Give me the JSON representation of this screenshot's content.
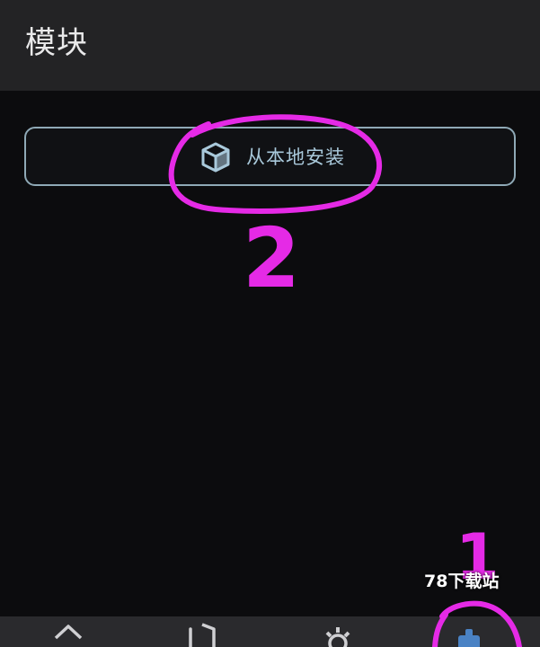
{
  "app_bar": {
    "title": "模块"
  },
  "install": {
    "label": "从本地安装",
    "icon": "package-icon"
  },
  "annotations": {
    "step1": "1",
    "step2": "2",
    "color": "#e52ae6"
  },
  "watermark": {
    "text": "78下载站"
  },
  "bottom_nav": {
    "items": [
      {
        "icon": "home-icon"
      },
      {
        "icon": "shield-icon"
      },
      {
        "icon": "gear-icon"
      },
      {
        "icon": "module-icon",
        "active": true
      }
    ],
    "active_color": "#4a82c4"
  },
  "colors": {
    "background": "#0c0c0e",
    "app_bar": "#232325",
    "button_border": "#8fa9b6",
    "button_text": "#a9c9db",
    "nav_bar": "#2a2a2d"
  }
}
